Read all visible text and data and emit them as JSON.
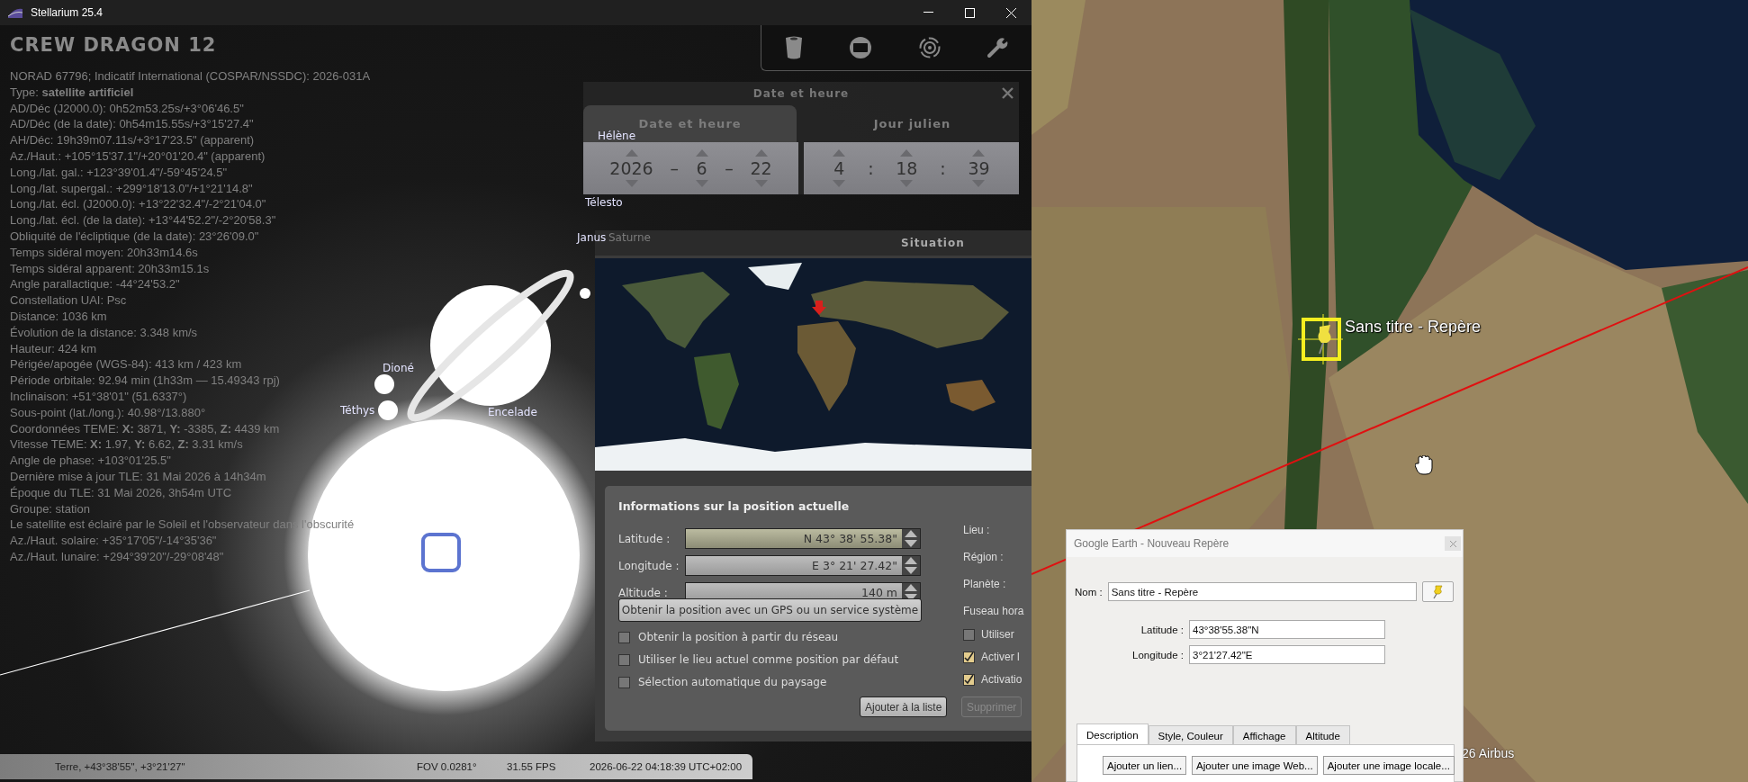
{
  "stellarium": {
    "window": {
      "title": "Stellarium 25.4"
    },
    "object_info": {
      "name": "CREW DRAGON 12",
      "lines": [
        "NORAD 67796; Indicatif International (COSPAR/NSSDC): 2026-031A",
        "Type: **satellite artificiel**",
        "AD/Déc (J2000.0): 0h52m53.25s/+3°06'46.5\"",
        "AD/Déc (de la date): 0h54m15.55s/+3°15'27.4\"",
        "AH/Déc: 19h39m07.11s/+3°17'23.5\" (apparent)",
        "Az./Haut.: +105°15'37.1\"/+20°01'20.4\" (apparent)",
        "Long./lat. gal.: +123°39'01.4\"/-59°45'24.5\"",
        "Long./lat. supergal.: +299°18'13.0\"/+1°21'14.8\"",
        "Long./lat. écl. (J2000.0): +13°22'32.4\"/-2°21'04.0\"",
        "Long./lat. écl. (de la date): +13°44'52.2\"/-2°20'58.3\"",
        "Obliquité de l'écliptique (de la date): 23°26'09.0\"",
        "Temps sidéral moyen: 20h33m14.6s",
        "Temps sidéral apparent: 20h33m15.1s",
        "Angle parallactique: -44°24'53.2\"",
        "Constellation UAI: Psc",
        "Distance: 1036 km",
        "Évolution de la distance: 3.348 km/s",
        "Hauteur: 424 km",
        "Périgée/apogée (WGS-84): 413 km / 423 km",
        "Période orbitale: 92.94 min (1h33m — 15.49343 rpj)",
        "Inclinaison: +51°38'01\" (51.6337°)",
        "Sous-point (lat./long.): 40.98°/13.880°",
        "Coordonnées TEME: **X:** 3871, **Y:** -3385, **Z:** 4439 km",
        "Vitesse TEME: **X:** 1.97, **Y:** 6.62, **Z:** 3.31 km/s",
        "Angle de phase: +103°01'25.5\"",
        "Dernière mise à jour TLE: 31 Mai 2026 à 14h34m",
        "Époque du TLE: 31 Mai 2026, 3h54m UTC",
        "Groupe: station",
        "Le satellite est éclairé par le Soleil et l'observateur dans l'obscurité",
        "Az./Haut. solaire: +35°17'05\"/-14°35'36\"",
        "Az./Haut. lunaire: +294°39'20\"/-29°08'48\""
      ]
    },
    "sky_labels": [
      {
        "text": "Hélène",
        "kind": "moon"
      },
      {
        "text": "Télesto",
        "kind": "moon"
      },
      {
        "text": "Janus",
        "kind": "moon"
      },
      {
        "text": "Saturne",
        "kind": "hidden"
      },
      {
        "text": "Dioné",
        "kind": "moon"
      },
      {
        "text": "Téthys",
        "kind": "moon"
      },
      {
        "text": "Encelade",
        "kind": "moon"
      }
    ],
    "date_dialog": {
      "title": "Date et heure",
      "tabs": [
        {
          "label": "Date et heure",
          "selected": true
        },
        {
          "label": "Jour julien",
          "selected": false
        }
      ],
      "date": {
        "values": [
          "2026",
          "6",
          "22"
        ],
        "separators": [
          "–",
          "–"
        ]
      },
      "time": {
        "values": [
          "4",
          "18",
          "39"
        ],
        "separators": [
          ":",
          ":"
        ]
      }
    },
    "situation_dialog": {
      "title": "Situation",
      "heading": "Informations sur la position actuelle",
      "fields": [
        {
          "label": "Latitude :",
          "value": "N 43° 38' 55.38\"",
          "focused": true
        },
        {
          "label": "Longitude :",
          "value": "E 3° 21' 27.42\"",
          "focused": false
        },
        {
          "label": "Altitude :",
          "value": "140 m",
          "focused": false
        }
      ],
      "gps_button": "Obtenir la position avec un GPS ou un service système",
      "checkboxes": [
        {
          "label": "Obtenir la position à partir du réseau",
          "checked": false
        },
        {
          "label": "Utiliser le lieu actuel comme position par défaut",
          "checked": false
        },
        {
          "label": "Sélection automatique du paysage",
          "checked": false
        }
      ],
      "side_labels": [
        "Lieu :",
        "Région :",
        "Planète :",
        "Fuseau hora"
      ],
      "side_checkboxes": [
        {
          "label": "Utiliser",
          "checked": false
        },
        {
          "label": "Activer l",
          "checked": true
        },
        {
          "label": "Activatio",
          "checked": true
        }
      ],
      "buttons": [
        {
          "label": "Ajouter à la liste",
          "disabled": false
        },
        {
          "label": "Supprimer",
          "disabled": true
        }
      ]
    },
    "status_bar": {
      "location": "Terre, +43°38'55\", +3°21'27\"",
      "fov": "FOV 0.0281°",
      "fps": "31.55 FPS",
      "datetime": "2026-06-22 04:18:39 UTC+02:00"
    }
  },
  "google_earth": {
    "placemark_label": "Sans titre - Repère",
    "attribution": "26 Airbus",
    "dialog": {
      "title": "Google Earth - Nouveau Repère",
      "name": {
        "label": "Nom :",
        "value": "Sans titre - Repère"
      },
      "coordinates": [
        {
          "label": "Latitude :",
          "value": "43°38'55.38\"N"
        },
        {
          "label": "Longitude :",
          "value": "3°21'27.42\"E"
        }
      ],
      "tabs": [
        {
          "label": "Description",
          "selected": true
        },
        {
          "label": "Style, Couleur",
          "selected": false
        },
        {
          "label": "Affichage",
          "selected": false
        },
        {
          "label": "Altitude",
          "selected": false
        }
      ],
      "buttons": [
        "Ajouter un lien...",
        "Ajouter une image Web...",
        "Ajouter une image locale..."
      ]
    }
  }
}
